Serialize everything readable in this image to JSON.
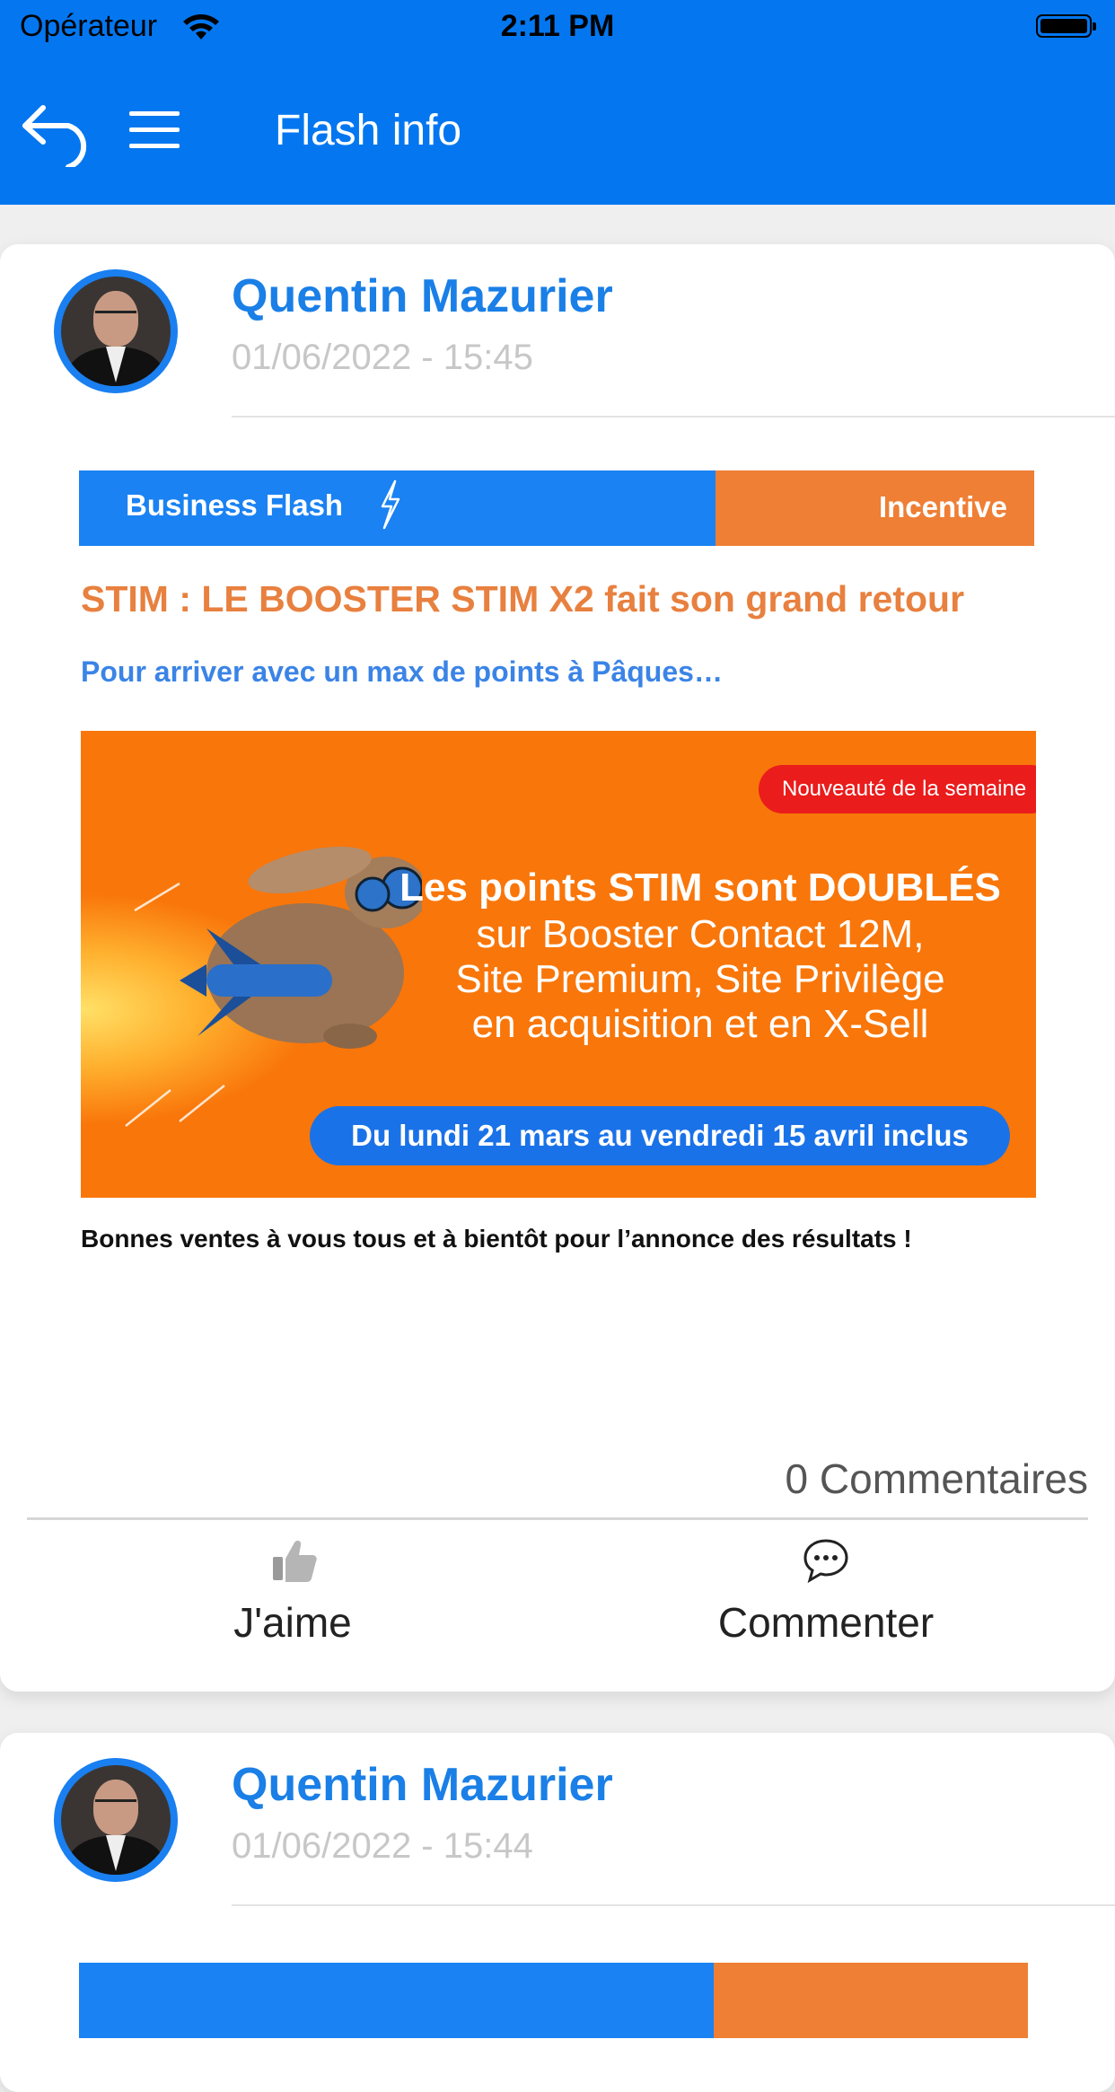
{
  "status_bar": {
    "carrier": "Opérateur",
    "time": "2:11 PM"
  },
  "nav": {
    "title": "Flash info"
  },
  "posts": [
    {
      "author": "Quentin Mazurier",
      "date": "01/06/2022 - 15:45",
      "flash": {
        "banner_left": "Business Flash",
        "banner_right": "Incentive",
        "headline": "STIM : LE BOOSTER STIM X2 fait son grand retour",
        "subheadline": "Pour arriver avec un max de points à Pâques…",
        "badge": "Nouveauté de la semaine",
        "promo_line1": "Les points STIM sont DOUBLÉS",
        "promo_line2": "sur Booster Contact 12M,",
        "promo_line3": "Site Premium, Site Privilège",
        "promo_line4": "en acquisition et en X-Sell",
        "promo_date": "Du lundi 21 mars au vendredi 15 avril inclus",
        "footer": "Bonnes ventes à vous tous et à bientôt pour l’annonce des résultats !"
      },
      "comment_count": "0 Commentaires",
      "like_label": "J'aime",
      "comment_label": "Commenter"
    },
    {
      "author": "Quentin Mazurier",
      "date": "01/06/2022 - 15:44"
    }
  ],
  "colors": {
    "primary": "#0477f0",
    "author": "#1a7fe6",
    "banner_orange": "#ee7f35",
    "promo_orange": "#f9760a"
  }
}
